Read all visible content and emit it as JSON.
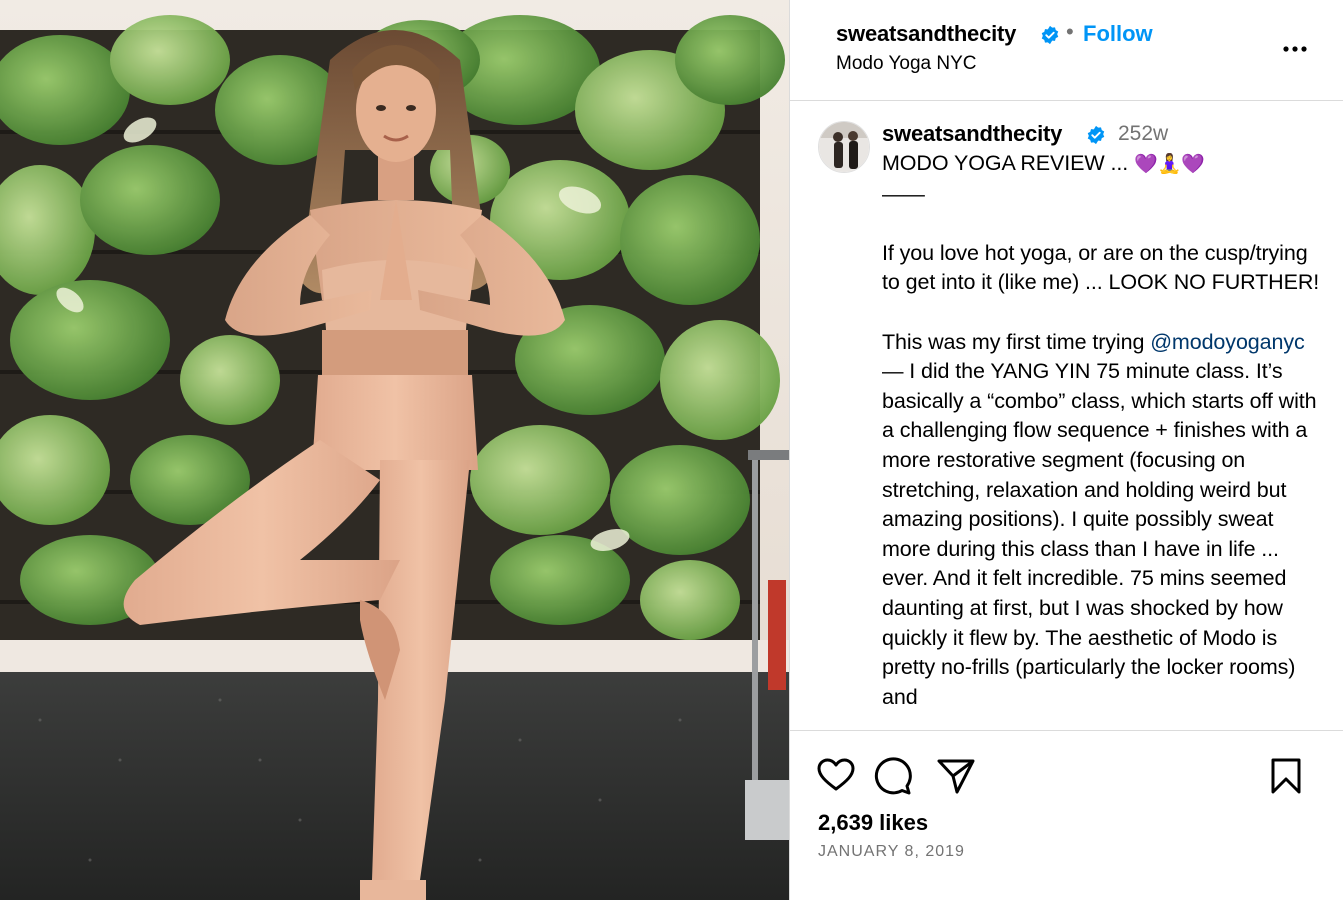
{
  "header": {
    "username": "sweatsandthecity",
    "separator": "•",
    "follow_label": "Follow",
    "location": "Modo Yoga NYC"
  },
  "comment": {
    "username": "sweatsandthecity",
    "time_ago": "252w",
    "title": "MODO YOGA REVIEW ...",
    "title_emojis": "💜🧘‍♀️💜",
    "divider": "——",
    "para1": "If you love hot yoga, or are on the cusp/trying to get into it (like me) ... LOOK NO FURTHER!",
    "para2_start": "This was my first time trying ",
    "mention": "@modoyoganyc",
    "para2_rest": " — I did the YANG YIN 75 minute class. It’s basically a “combo” class, which starts off with a challenging flow sequence + finishes with a more restorative segment (focusing on stretching, relaxation and holding weird but amazing positions). I quite possibly sweat more during this class than I have in life ... ever. And it felt incredible. 75 mins seemed daunting at first, but I was shocked by how quickly it flew by. The aesthetic of Modo is pretty no-frills (particularly the locker rooms) and"
  },
  "footer": {
    "likes": "2,639 likes",
    "date": "JANUARY 8, 2019"
  },
  "icons": {
    "verified": "verified-badge-icon",
    "more": "more-options-icon",
    "like": "heart-icon",
    "comment": "comment-bubble-icon",
    "share": "paper-plane-icon",
    "save": "bookmark-icon"
  },
  "colors": {
    "follow": "#0095f6",
    "verified": "#0095f6",
    "mention": "#00376b",
    "muted": "#737373"
  }
}
